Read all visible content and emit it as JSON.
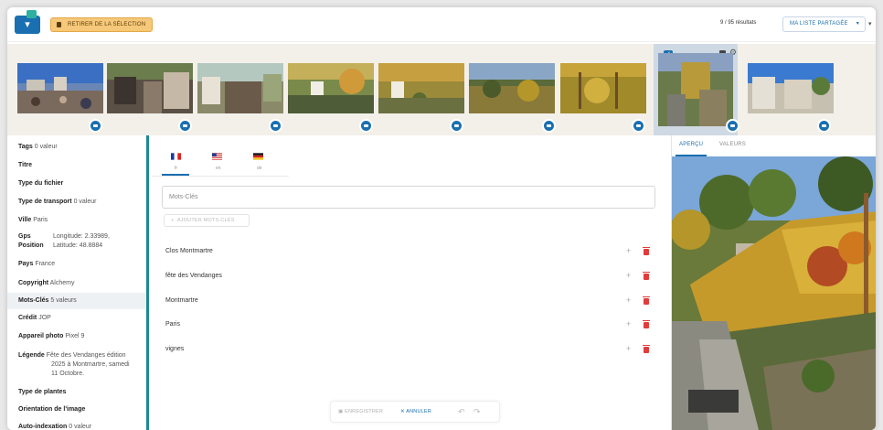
{
  "header": {
    "remove_selection_label": "RETIRER DE LA SÉLECTION",
    "results_text": "9 / 95 résultats",
    "shared_list_label": "MA LISTE PARTAGÉE"
  },
  "strip": {
    "thumbnails": [
      "photo-1",
      "photo-2",
      "photo-3",
      "photo-4",
      "photo-5",
      "photo-6",
      "photo-7",
      "photo-8",
      "photo-9"
    ],
    "selected_index": 7
  },
  "metadata": {
    "tags": {
      "label": "Tags",
      "value": "0 valeur"
    },
    "titre": {
      "label": "Titre"
    },
    "type_fichier": {
      "label": "Type du fichier"
    },
    "type_transport": {
      "label": "Type de transport",
      "value": "0 valeur"
    },
    "ville": {
      "label": "Ville",
      "value": "Paris"
    },
    "gps": {
      "label1": "Gps",
      "label2": "Position",
      "lon": "Longitude: 2.33989,",
      "lat": "Latitude: 48.8884"
    },
    "pays": {
      "label": "Pays",
      "value": "France"
    },
    "copyright": {
      "label": "Copyright",
      "value": "Alchemy"
    },
    "mots_cles": {
      "label": "Mots-Clés",
      "value": "5 valeurs"
    },
    "credit": {
      "label": "Crédit",
      "value": "JOP"
    },
    "appareil": {
      "label": "Appareil photo",
      "value": "Pixel 9"
    },
    "legende": {
      "label": "Légende",
      "line1": "Fête des Vendanges édition",
      "line2": "2025 à Montmartre, samedi",
      "line3": "11 Octobre."
    },
    "type_plantes": {
      "label": "Type de plantes"
    },
    "orientation": {
      "label": "Orientation de l'image"
    },
    "auto_index": {
      "label": "Auto-indexation",
      "value": "0 valeur"
    }
  },
  "languages": [
    {
      "code": "fr",
      "flag": "france-flag"
    },
    {
      "code": "en",
      "flag": "usa-flag"
    },
    {
      "code": "de",
      "flag": "germany-flag"
    }
  ],
  "keywords": {
    "placeholder": "Mots-Clés",
    "add_label": "AJOUTER MOTS-CLÉS",
    "items": [
      "Clos Montmartre",
      "fête des Vendanges",
      "Montmartre",
      "Paris",
      "vignes"
    ]
  },
  "actions": {
    "save_label": "ENREGISTRER",
    "cancel_label": "ANNULER"
  },
  "preview_panel": {
    "tab_preview": "APERÇU",
    "tab_values": "VALEURS"
  },
  "colors": {
    "accent": "#1a6fb0",
    "warning": "#f5c87a",
    "teal": "#1a8a93",
    "delete": "#e23b3b"
  }
}
